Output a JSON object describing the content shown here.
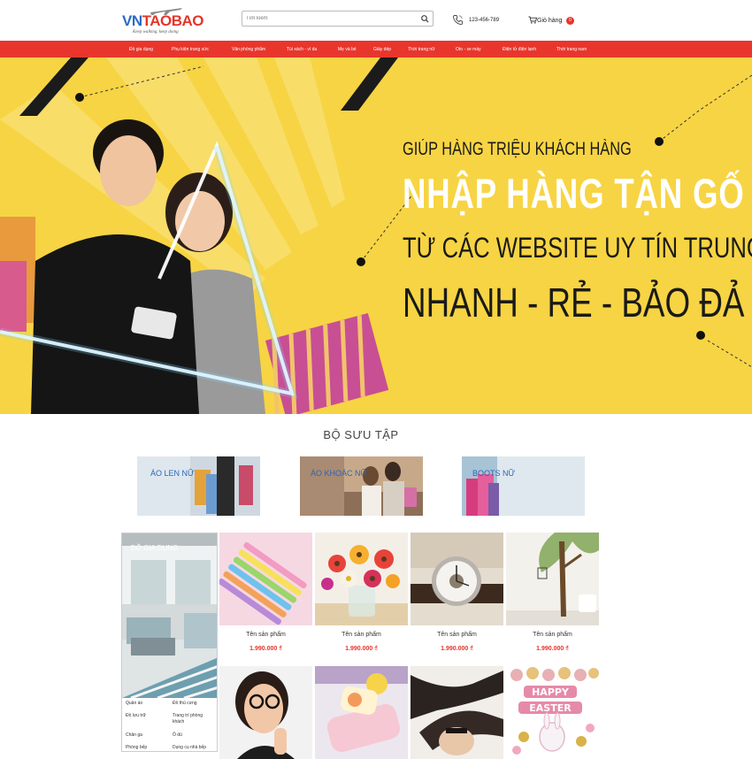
{
  "header": {
    "logo_vn": "VN",
    "logo_taobao": "TAOBAO",
    "logo_tagline": "Keep walking, keep doing",
    "search_placeholder": "Tìm kiếm",
    "phone": "123-456-789",
    "cart_label": "Giỏ hàng",
    "cart_count": "0"
  },
  "nav": {
    "items": [
      "Đồ gia dụng",
      "Phụ kiện trang sức",
      "Văn phòng phẩm",
      "Túi xách - ví da",
      "Mẹ và bé",
      "Giày dép",
      "Thời trang nữ",
      "Oto - xe máy",
      "Điện tử điện lạnh",
      "Thời trang nam"
    ]
  },
  "banner": {
    "line1": "GIÚP HÀNG TRIỆU KHÁCH HÀNG",
    "line2": "NHẬP HÀNG TẬN GỐ",
    "line3": "TỪ CÁC WEBSITE UY TÍN TRUNG QU",
    "line4": "NHANH - RẺ - BẢO ĐẢ",
    "bg_color": "#f7d443"
  },
  "collection": {
    "title": "BỘ SƯU TẬP",
    "cards": [
      "ÁO LEN NỮ",
      "ÁO KHOÁC NỮ",
      "BOOTS NỮ"
    ]
  },
  "category": {
    "title": "ĐỒ GIA DỤNG",
    "links": [
      [
        "Quần áo",
        "Đồ thú cưng"
      ],
      [
        "Đồ lưu trữ",
        "Trang trí phòng khách"
      ],
      [
        "Chăn ga",
        "Ô dù"
      ],
      [
        "Phòng bếp",
        "Dụng cụ nhà bếp"
      ]
    ]
  },
  "products": [
    {
      "name": "Tên sản phẩm",
      "price": "1.990.000 ₫",
      "icon": "highlighter-pens"
    },
    {
      "name": "Tên sản phẩm",
      "price": "1.990.000 ₫",
      "icon": "flower-vase"
    },
    {
      "name": "Tên sản phẩm",
      "price": "1.990.000 ₫",
      "icon": "wrist-watch"
    },
    {
      "name": "Tên sản phẩm",
      "price": "1.990.000 ₫",
      "icon": "tree-wall-sticker"
    },
    {
      "name": "",
      "price": "",
      "icon": "woman-glasses"
    },
    {
      "name": "",
      "price": "",
      "icon": "pencil-case"
    },
    {
      "name": "",
      "price": "",
      "icon": "stockings"
    },
    {
      "name": "",
      "price": "",
      "icon": "easter-balloons"
    }
  ],
  "colors": {
    "accent": "#e8362c",
    "price": "#e5352b",
    "link_blue": "#2a66b8"
  }
}
